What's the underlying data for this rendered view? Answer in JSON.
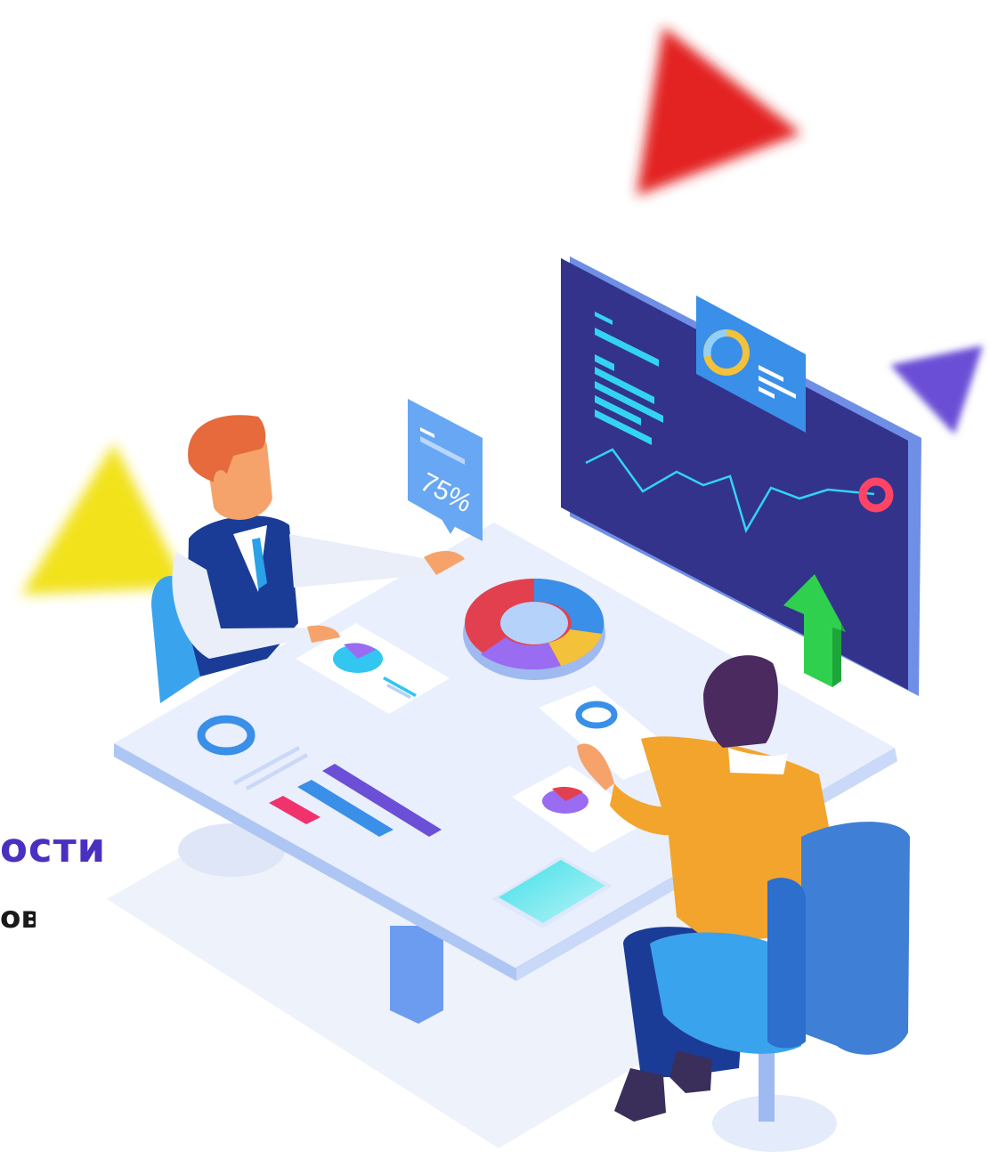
{
  "illustration": {
    "badge_text": "75%",
    "heading_fragment": "ости",
    "subheading_fragment": "ов",
    "colors": {
      "red": "#e32323",
      "yellow": "#f2e21c",
      "violet": "#6b4fd6",
      "monitor": "#33338c",
      "accent_blue": "#3a8fe8",
      "green": "#2fd04e",
      "purple_title": "#4b2fc0"
    }
  }
}
